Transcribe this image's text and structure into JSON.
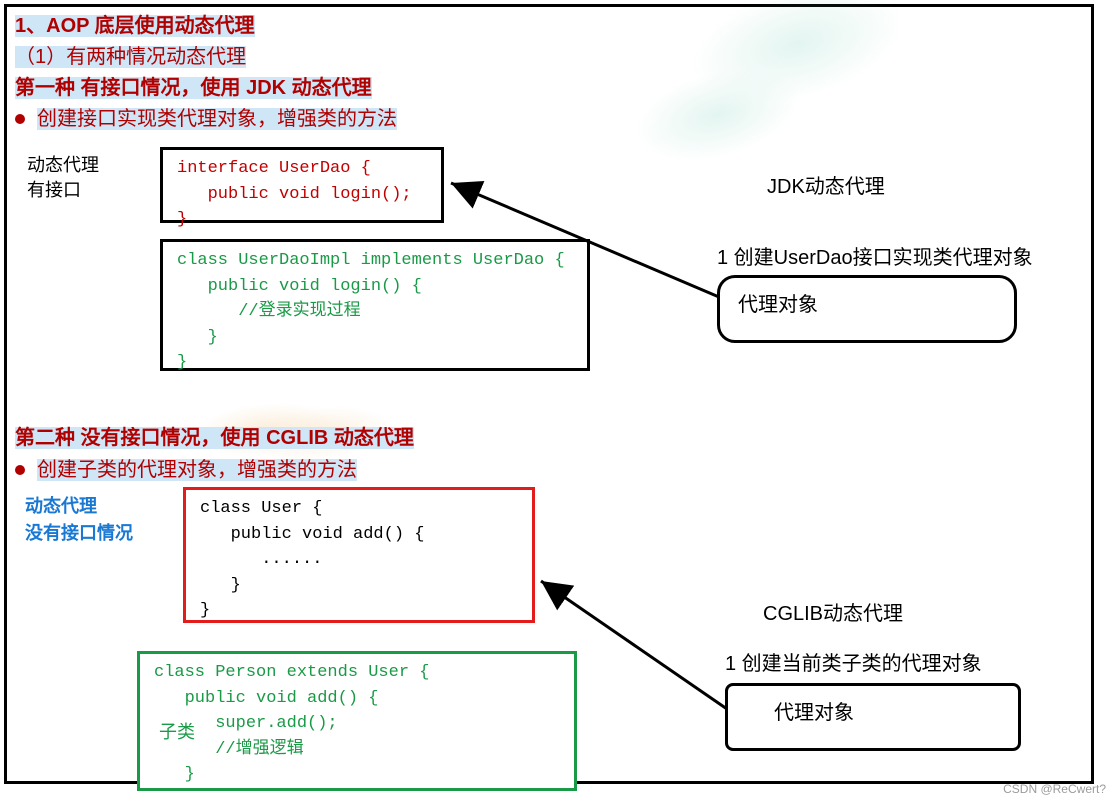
{
  "headings": {
    "h1": "1、AOP 底层使用动态代理",
    "s1": "（1）有两种情况动态代理",
    "h2": "第一种 有接口情况，使用 JDK 动态代理",
    "b1": "创建接口实现类代理对象，增强类的方法",
    "h3": "第二种 没有接口情况，使用 CGLIB 动态代理",
    "b2": "创建子类的代理对象，增强类的方法"
  },
  "side": {
    "jdk_l1": "动态代理",
    "jdk_l2": "有接口",
    "cglib_l1": "动态代理",
    "cglib_l2": "没有接口情况",
    "subclass": "子类"
  },
  "code": {
    "interface": "interface UserDao {\n   public void login();\n}",
    "impl": "class UserDaoImpl implements UserDao {\n   public void login() {\n      //登录实现过程\n   }\n}",
    "user": "class User {\n   public void add() {\n      ......\n   }\n}",
    "person": "class Person extends User {\n   public void add() {\n      super.add();\n      //增强逻辑\n   }"
  },
  "right": {
    "jdk_title": "JDK动态代理",
    "jdk_step": "1  创建UserDao接口实现类代理对象",
    "cglib_title": "CGLIB动态代理",
    "cglib_step": "1  创建当前类子类的代理对象",
    "proxy": "代理对象"
  },
  "watermark": "CSDN @ReCwert?"
}
